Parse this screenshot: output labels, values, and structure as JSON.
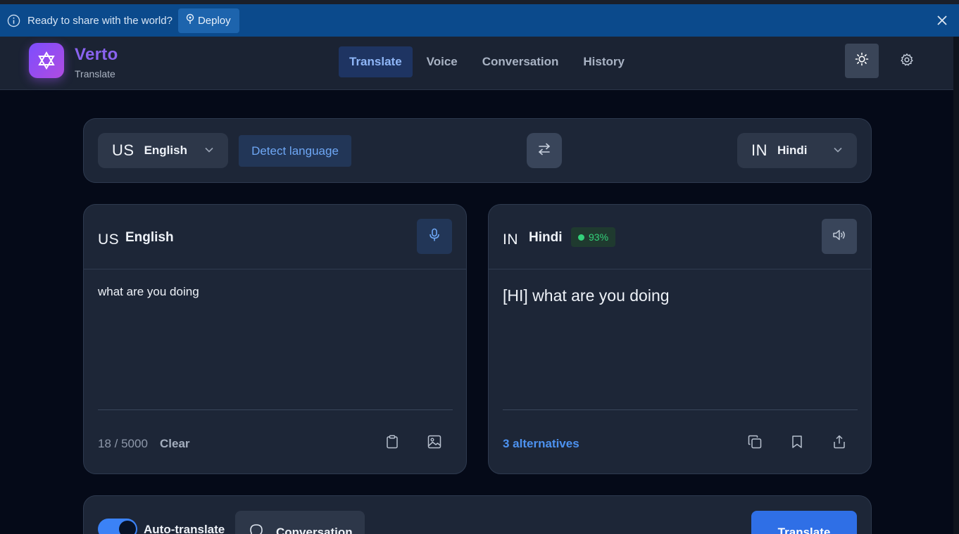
{
  "banner": {
    "message": "Ready to share with the world?",
    "deploy_label": "Deploy"
  },
  "brand": {
    "name": "Verto",
    "subtitle": "Translate"
  },
  "nav": {
    "items": [
      {
        "label": "Translate",
        "active": true
      },
      {
        "label": "Voice",
        "active": false
      },
      {
        "label": "Conversation",
        "active": false
      },
      {
        "label": "History",
        "active": false
      }
    ]
  },
  "language_bar": {
    "source": {
      "flag": "US",
      "name": "English"
    },
    "detect_label": "Detect language",
    "target": {
      "flag": "IN",
      "name": "Hindi"
    }
  },
  "source_card": {
    "flag": "US",
    "language": "English",
    "text": "what are you doing",
    "char_count": "18 / 5000",
    "clear_label": "Clear"
  },
  "target_card": {
    "flag": "IN",
    "language": "Hindi",
    "confidence": "93%",
    "text": "[HI] what are you doing",
    "alternatives_label": "3 alternatives"
  },
  "bottom_bar": {
    "auto_translate_label": "Auto-translate",
    "auto_translate_on": true,
    "conversation_label": "Conversation",
    "translate_label": "Translate"
  },
  "colors": {
    "accent": "#3b82f6",
    "brand": "#8a63f0",
    "banner": "#0b4a8c",
    "confidence": "#33d17a"
  },
  "icons": [
    "info-icon",
    "deploy-icon",
    "close-icon",
    "logo-icon",
    "sun-icon",
    "gear-icon",
    "chevron-down-icon",
    "swap-icon",
    "microphone-icon",
    "speaker-icon",
    "clipboard-icon",
    "image-icon",
    "copy-icon",
    "bookmark-icon",
    "share-icon",
    "chat-icon"
  ]
}
